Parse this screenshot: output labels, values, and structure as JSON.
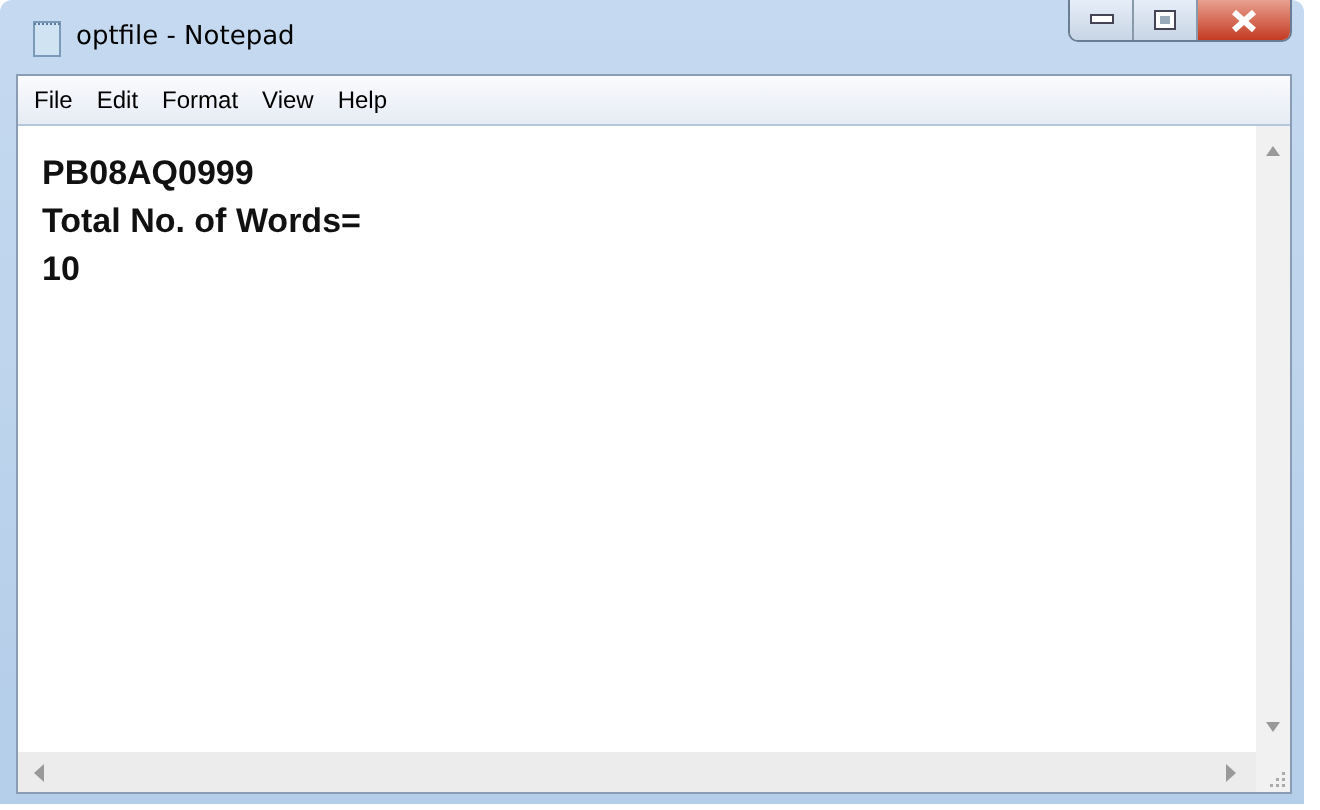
{
  "window": {
    "title": "optfile - Notepad"
  },
  "menu": [
    "File",
    "Edit",
    "Format",
    "View",
    "Help"
  ],
  "document": {
    "lines": [
      "PB08AQ0999",
      "Total No. of Words=",
      "10"
    ]
  }
}
